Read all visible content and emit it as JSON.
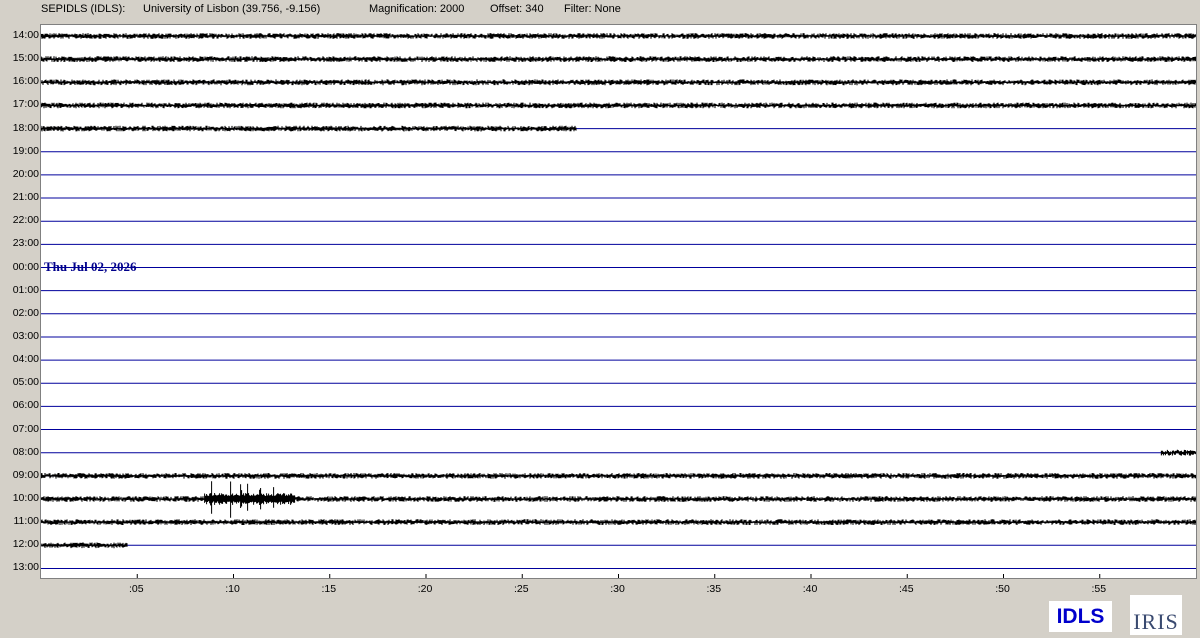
{
  "header": {
    "station": "SEPIDLS (IDLS):",
    "location": "University of Lisbon (39.756, -9.156)",
    "magnification": "Magnification: 2000",
    "offset": "Offset: 340",
    "filter": "Filter: None"
  },
  "date_label": "Thu Jul 02, 2026",
  "logos": {
    "station": "IDLS",
    "network": "IRIS"
  },
  "colors": {
    "baseline": "#00009c",
    "trace": "#000000",
    "date": "#00008b",
    "background": "#d4d0c8"
  },
  "chart_data": {
    "type": "line",
    "rows": [
      "14:00",
      "15:00",
      "16:00",
      "17:00",
      "18:00",
      "19:00",
      "20:00",
      "21:00",
      "22:00",
      "23:00",
      "00:00",
      "01:00",
      "02:00",
      "03:00",
      "04:00",
      "05:00",
      "06:00",
      "07:00",
      "08:00",
      "09:00",
      "10:00",
      "11:00",
      "12:00",
      "13:00"
    ],
    "x_ticks": [
      ":05",
      ":10",
      ":15",
      ":20",
      ":25",
      ":30",
      ":35",
      ":40",
      ":45",
      ":50",
      ":55"
    ],
    "xlim": [
      0,
      60
    ],
    "data_segments": [
      {
        "row": "14:00",
        "start_min": 0,
        "end_min": 60,
        "amplitude": "normal"
      },
      {
        "row": "15:00",
        "start_min": 0,
        "end_min": 60,
        "amplitude": "normal"
      },
      {
        "row": "16:00",
        "start_min": 0,
        "end_min": 60,
        "amplitude": "normal"
      },
      {
        "row": "17:00",
        "start_min": 0,
        "end_min": 60,
        "amplitude": "normal"
      },
      {
        "row": "18:00",
        "start_min": 0,
        "end_min": 27.8,
        "amplitude": "normal"
      },
      {
        "row": "08:00",
        "start_min": 58.2,
        "end_min": 60,
        "amplitude": "normal"
      },
      {
        "row": "09:00",
        "start_min": 0,
        "end_min": 60,
        "amplitude": "normal"
      },
      {
        "row": "10:00",
        "start_min": 0,
        "end_min": 60,
        "amplitude": "normal"
      },
      {
        "row": "11:00",
        "start_min": 0,
        "end_min": 60,
        "amplitude": "normal"
      },
      {
        "row": "12:00",
        "start_min": 0,
        "end_min": 4.5,
        "amplitude": "normal"
      }
    ],
    "events": [
      {
        "row": "10:00",
        "start_min": 8.5,
        "end_min": 13.2
      }
    ]
  }
}
